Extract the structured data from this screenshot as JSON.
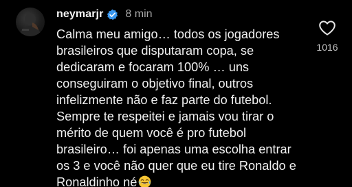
{
  "comment": {
    "username": "neymarjr",
    "time_ago": "8 min",
    "verified": true,
    "avatar_icon": "profile-photo",
    "lines": [
      "Calma meu amigo… todos os jogadores",
      "brasileiros que disputaram copa, se",
      "dedicaram e focaram 100% … uns",
      "conseguiram o objetivo final, outros",
      "infelizmente não e faz parte do futebol.",
      "Sempre te respeitei e jamais vou tirar o",
      "mérito de quem você é pro futebol",
      "brasileiro… foi apenas uma escolha entrar",
      "os 3 e você não quer que eu tire Ronaldo e",
      "Ronaldinho né"
    ],
    "emoji": "tears-of-joy-emoji",
    "like_icon": "heart-outline-icon",
    "like_count": "1016"
  },
  "colors": {
    "background": "#000000",
    "text": "#f0f0f0",
    "secondary_text": "#a8a8a8",
    "verified_badge": "#3897f0"
  }
}
